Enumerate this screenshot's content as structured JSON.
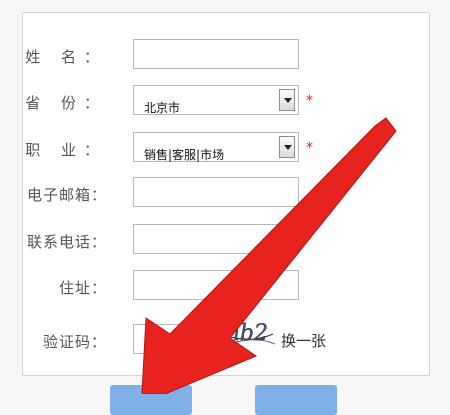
{
  "form": {
    "name_label": "姓 名：",
    "province_label": "省 份：",
    "province_value": "北京市",
    "occupation_label": "职 业：",
    "occupation_value": "销售|客服|市场",
    "email_label": "电子邮箱：",
    "phone_label": "联系电话：",
    "address_label": "住址：",
    "captcha_label": "验证码：",
    "captcha_text": "8mb2",
    "refresh_label": "换一张",
    "required_mark": "*"
  },
  "colors": {
    "arrow": "#e8231f",
    "required": "#e02020",
    "button": "#7fb0e8"
  }
}
